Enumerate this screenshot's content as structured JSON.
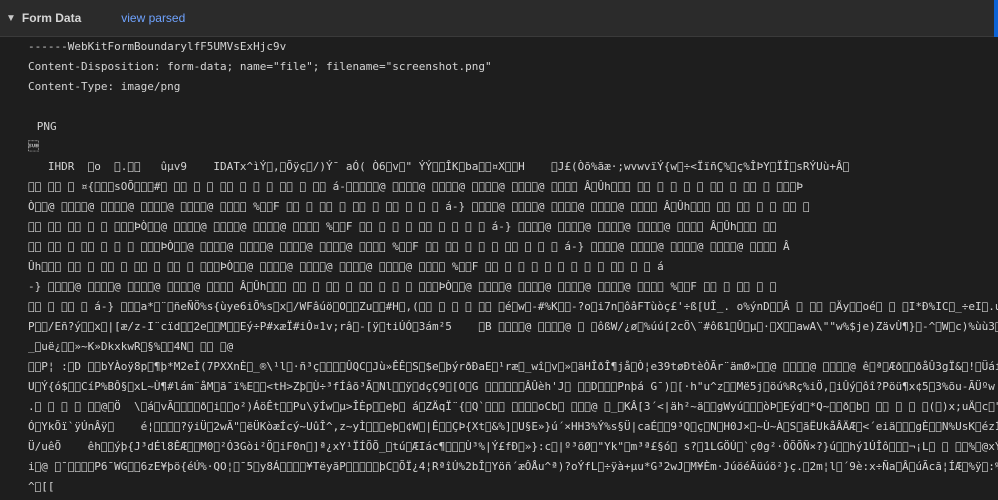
{
  "header": {
    "caret": "▼",
    "title": "Form Data",
    "link": "view parsed"
  },
  "raw": {
    "lines": [
      "------WebKitFormBoundarylfF5UMVsExHjc9v",
      "Content-Disposition: form-data; name=\"file\"; filename=\"screenshot.png\"",
      "Content-Type: image/png",
      "",
      "PNG",
      "\u001a",
      "   IHDR  \u0000o  \u0000.\u0000\u0000   ûµv9    IDATx^ìÝ\u0000,\u0000Õÿç\u0000/)Ý¯ aÓ( Ò6\u0000v\u0000\" ÝÝ\u0000\u0000ÎK\u0000ba\u0000\u0000¤X\u0000\u0000H    \u0000J£(Òõ%ãæ·;wvwvïÝ{w\u0000÷<ÏïñÇ%\u0000ç%ÎÞY\u0000ÏÎ\u0000sRÝUù+Â\u0000",
      "\u0000\u0000 \u0000\u0000 \u0000 ¤{\u0000\u0000\u0000sOÕ\u0000\u0000\u0000#\u0000 \u0000\u0000 \u0000 \u0000 \u0000\u0000 \u0000 \u0000 \u0000 \u0000\u0000 \u0000 \u0000\u0000 á-\u0000\u0000\u0000\u0000\u0000@ \u0000\u0000\u0000\u0000@ \u0000\u0000\u0000\u0000@ \u0000\u0000\u0000\u0000@ \u0000\u0000\u0000\u0000@ \u0000\u0000\u0000\u0000 Â\u0000Ûh\u0000\u0000\u0000 \u0000\u0000 \u0000 \u0000 \u0000 \u0000 \u0000\u0000 \u0000 \u0000\u0000 \u0000 \u0000\u0000\u0000Þ",
      "Ò\u0000\u0000@ \u0000\u0000\u0000\u0000@ \u0000\u0000\u0000\u0000@ \u0000\u0000\u0000\u0000@ \u0000\u0000\u0000\u0000@ \u0000\u0000\u0000\u0000 %\u0000\u0000F \u0000\u0000 \u0000 \u0000\u0000 \u0000 \u0000\u0000 \u0000 \u0000\u0000 \u0000 \u0000 \u0000 á-} \u0000\u0000\u0000\u0000@ \u0000\u0000\u0000\u0000@ \u0000\u0000\u0000\u0000@ \u0000\u0000\u0000\u0000@ \u0000\u0000\u0000\u0000 Â\u0000Ûh\u0000\u0000\u0000 \u0000\u0000 \u0000\u0000 \u0000 \u0000 \u0000\u0000 \u0000",
      "\u0000\u0000 \u0000\u0000 \u0000\u0000 \u0000 \u0000 \u0000\u0000\u0000ÞÒ\u0000\u0000@ \u0000\u0000\u0000\u0000@ \u0000\u0000\u0000\u0000@ \u0000\u0000\u0000\u0000@ \u0000\u0000\u0000\u0000 %\u0000\u0000F \u0000\u0000 \u0000 \u0000 \u0000 \u0000\u0000 \u0000 \u0000 \u0000 \u0000 á-} \u0000\u0000\u0000\u0000@ \u0000\u0000\u0000\u0000@ \u0000\u0000\u0000\u0000@ \u0000\u0000\u0000\u0000@ \u0000\u0000\u0000\u0000 Â\u0000Ûh\u0000\u0000\u0000 \u0000\u0000",
      "\u0000\u0000 \u0000\u0000 \u0000 \u0000\u0000 \u0000 \u0000 \u0000 \u0000\u0000\u0000ÞÒ\u0000\u0000@ \u0000\u0000\u0000\u0000@ \u0000\u0000\u0000\u0000@ \u0000\u0000\u0000\u0000@ \u0000\u0000\u0000\u0000@ \u0000\u0000\u0000\u0000 %\u0000\u0000F \u0000\u0000 \u0000\u0000 \u0000 \u0000 \u0000 \u0000\u0000 \u0000 \u0000 \u0000 á-} \u0000\u0000\u0000\u0000@ \u0000\u0000\u0000\u0000@ \u0000\u0000\u0000\u0000@ \u0000\u0000\u0000\u0000@ \u0000\u0000\u0000\u0000 Â",
      "Ûh\u0000\u0000\u0000 \u0000\u0000 \u0000 \u0000\u0000 \u0000 \u0000\u0000 \u0000 \u0000\u0000 \u0000 \u0000\u0000\u0000ÞÒ\u0000\u0000@ \u0000\u0000\u0000\u0000@ \u0000\u0000\u0000\u0000@ \u0000\u0000\u0000\u0000@ \u0000\u0000\u0000\u0000@ \u0000\u0000\u0000\u0000 %\u0000\u0000F \u0000\u0000 \u0000 \u0000 \u0000 \u0000 \u0000 \u0000 \u0000 \u0000 \u0000\u0000 \u0000 \u0000 á",
      "-} \u0000\u0000\u0000\u0000@ \u0000\u0000\u0000\u0000@ \u0000\u0000\u0000\u0000@ \u0000\u0000\u0000\u0000@ \u0000\u0000\u0000\u0000 Â\u0000Ûh\u0000\u0000\u0000 \u0000\u0000 \u0000 \u0000\u0000 \u0000 \u0000\u0000 \u0000 \u0000 \u0000 \u0000\u0000\u0000ÞÒ\u0000\u0000@ \u0000\u0000\u0000\u0000@ \u0000\u0000\u0000\u0000@ \u0000\u0000\u0000\u0000@ \u0000\u0000\u0000\u0000@ \u0000\u0000\u0000\u0000 %\u0000\u0000F \u0000\u0000 \u0000 \u0000\u0000 \u0000 \u0000",
      "\u0000\u0000 \u0000 \u0000\u0000 \u0000 á-} \u0000\u0000\u0000a*\u0000¨\u0000ñeÑÖ%s{ùye6iÕ%s\u0000x\u0000/WFâúö\u0000O\u0000\u0000Zu\u0000\u0000#H\u0000,(\u0000\u0000 \u0000 \u0000 \u0000 \u0000\u0000 \u0000é\u0000w\u0000-#%K\u0000\u0000-?o\u0000i7n\u0000ôâFTùòç£'÷ß[UÎ_. o%ýnD\u0000\u0000Â \u0000 \u0000\u0000 \u0000Äy\u0000\u0000oé\u0000 \u0000 \u0000I*Ð%IC\u0000_÷eI\u0000.u",
      "P\u0000\u0000/Eñ?ý\u0000\u0000x\u0000|[æ/z-I¨cïd\u0000\u00002e\u0000\u0000M\u0000\u0000Eý÷P#xæÏ#iÒ¤1v;râ\u0000-[ÿ\u0000tiÚÓ\u00003ám²5    \u0000B \u0000\u0000\u0000\u0000@ \u0000\u0000\u0000\u0000@ \u0000 \u0000ôßW/¿ø\u0000%úú[2cÖ\\¨#ôß1\u0000Û\u0000µ\u0000·\u0000X\u0000\u0000awA\\\"\"w%$je)ZävÙ¶}\u0000-^\u0000W\u0000c)%ùù3\u00003G\u0000«~çÏ",
      "_\u0000uë¿\u0000\u0000»~K»DkxkwR\u0000§%\u0000\u00004N\u0000 \u0000\u0000 \u0000@",
      "\u0000\u0000P¦ :\u0000D \u0000\u0000bYÀoÿ8p\u0000¶þ*M2eÌ(7PXXnÈ\u0000_®\\¹l\u0000·ñ³ç\u0000\u0000\u0000\u0000ÛQC\u0000Jù»ÊÊ\u0000S\u0000$e\u0000þýrðÐaE\u0000¹ræ\u0000_wî\u0000v\u0000»\u0000äHÎðÎ¶jå\u0000Ò¦e39tøÐtèÒÃr¨ämØ»\u0000\u0000@ \u0000\u0000\u0000\u0000@ \u0000\u0000\u0000\u0000@ ê\u0000ª\u0000Æð\u0000\u0000ðåÛ3gÏ&\u0000!\u0000Üáím·P\"U*",
      "U\u0000Ý{ó$\u0000\u0000CíP%BÔ§\u0000xL~Ù¶#lám¨åM\u0000ã¯ï%E\u0000\u0000<tH>Zþ\u0000Ù÷³fÍâõ³Ã\u0000Nl\u0000\u0000ÿ\u0000dçÇ9\u0000[O\u0000G \u0000\u0000\u0000\u0000\u0000\u0000ÂÛèh'J\u0000 \u0000\u0000D\u0000\u0000\u0000Pnþá G¯)\u0000[·h\"u^z\u0000\u0000Më5j\u0000öú%Rç%iÖ,\u0000iÛý\u0000ôî?Pöü¶x¢5\u00003%õu-ÃÜºw",
      ".\u0000 \u0000 \u0000 \u0000 \u0000\u0000@\u0000Ö  \\\u0000á\u0000vÃ\u0000\u0000\u0000\u0000ð\u0000i\u0000\u0000o²)ÁöÊt\u0000\u0000Pu\\ÿÍw\u0000µ>ÎÈp\u0000\u0000eþ\u0000 á\u0000ZÄqÏ¨{\u0000Q`\u0000\u0000\u0000 \u0000\u0000\u0000\u0000oCb\u0000 \u0000\u0000\u0000@ \u0000_\u0000KÂ[3´<|äh²~ä\u0000\u0000gWyú\u0000\u0000\u0000òÞ\u0000Eýd\u0000*Q~\u0000\u0000ð\u0000b\u0000 \u0000\u0000 \u0000 \u0000 \u0000(\u0000)x;uÄ\u0000c\u0000\"s",
      "Ó\u0000YkÕï`ÿÚnÂÿ\u0000    é¦\u0000\u0000\u0000\u0000?ÿiÜ\u00002wÃ\"\u0000ëÜKòæÍcý~UûÎ^,z~yÌ\u0000\u0000\u0000eþ\u0000¢W\u0000|Ê\u0000\u0000ÇÞ{Xt\u0000&%]\u0000U§E»}ú´×HH3%Ý%s§Ü|caÉ\u0000\u00009³Q\u0000ç\u0000N\u0000H0J×\u0000~Ù~À\u0000S\u0000ãËUkåÂÄÆ\u0000<´eiä\u0000\u0000\u0000gÈ\u0000\u0000N%UsK\u0000ézÍ\u0000¥;viò;\u0000x",
      "Ü/uêÕ    êh\u0000\u0000ýþ{J³dÉl8ÊÆ\u0000\u0000M0\u0000²Ó3Gòi²Ö\u0000iF0n\u0000]ª¿xY¹ÏÍÕÕ_\u0000tú\u0000ÆIác¶\u0000\u0000\u0000Ù³%|Ý£fÐ\u0000»}:c\u0000|º³öØ\u0000\"Yk\"\u0000m³ª£§ó\u0000 s?\u00001LGÖÚ\u0000`ç0g²·ÖÕÕÑ×?}ú\u0000\u0000hý1ÚÎô\u0000\u0000\u0000¬¡L\u0000 \u0000 \u0000\u0000%\u0000@xÝiA",
      "i\u0000@ \u0000¯\u0000\u0000\u0000\u0000P6¯WG\u0000\u00006zE¥þö{éÚ%·QO¦\u0000¯5\u0000y8Á\u0000\u0000\u0000\u0000¥TëyãP\u0000\u0000\u0000\u0000\u0000þC\u0000ÕÏ¿4¦RªîÚ%2bÎ\u0000Yöñ´æÔÅu^ª)?oÝfL\u0000÷ÿà+µu*G³2wJ\u0000M¥Èm·JúöéÃüúö²}ç.\u00002m¦l\u0000´9è:x÷Ña\u0000Â\u0000úÃcã¦ÍÆ\u0000%ÿ\u0000:%\u0000_{C",
      "^\u0000[["
    ]
  }
}
